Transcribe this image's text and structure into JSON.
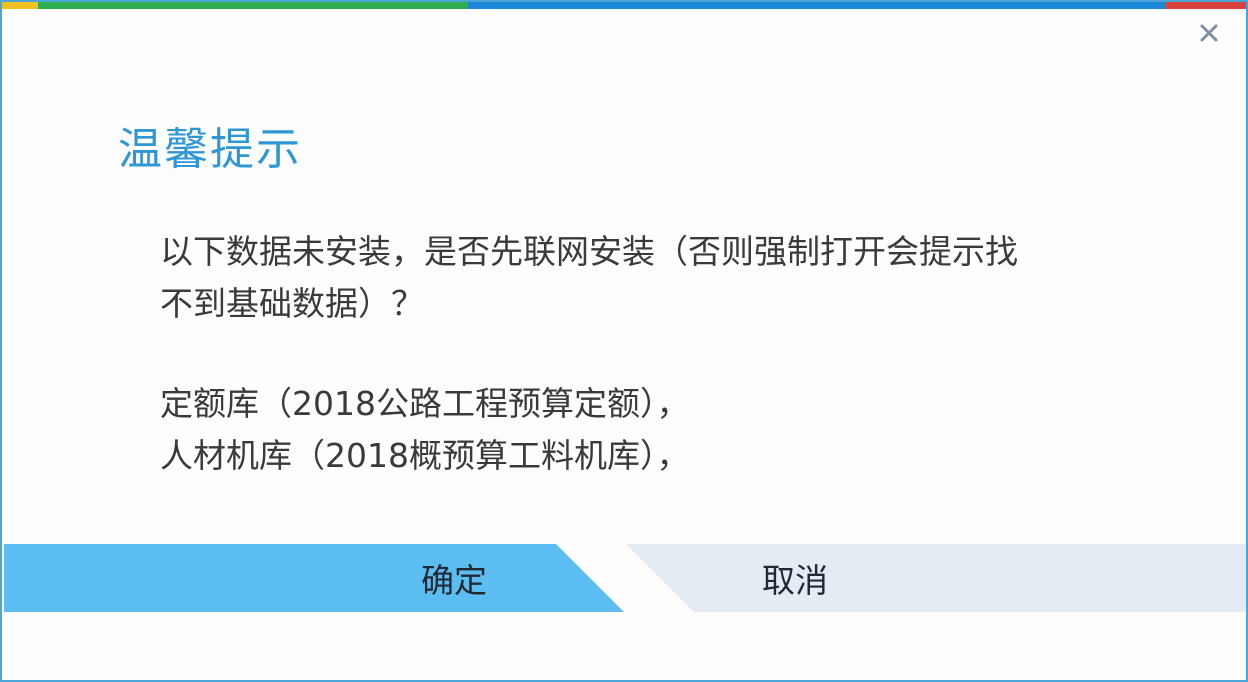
{
  "dialog": {
    "title": "温馨提示",
    "close_icon": "close-icon",
    "message_lines": [
      "以下数据未安装，是否先联网安装（否则强制打开会提示找",
      "不到基础数据）？"
    ],
    "items": [
      "定额库（2018公路工程预算定额），",
      "人材机库（2018概预算工料机库），"
    ],
    "ok_label": "确定",
    "cancel_label": "取消"
  },
  "colors": {
    "title": "#2f97d4",
    "ok_button": "#5cbdf0",
    "cancel_button": "#e4ebf3",
    "border": "#4aa6d8",
    "strip": [
      "#f0c21f",
      "#2fae4e",
      "#1a86d8",
      "#d9413a"
    ]
  }
}
